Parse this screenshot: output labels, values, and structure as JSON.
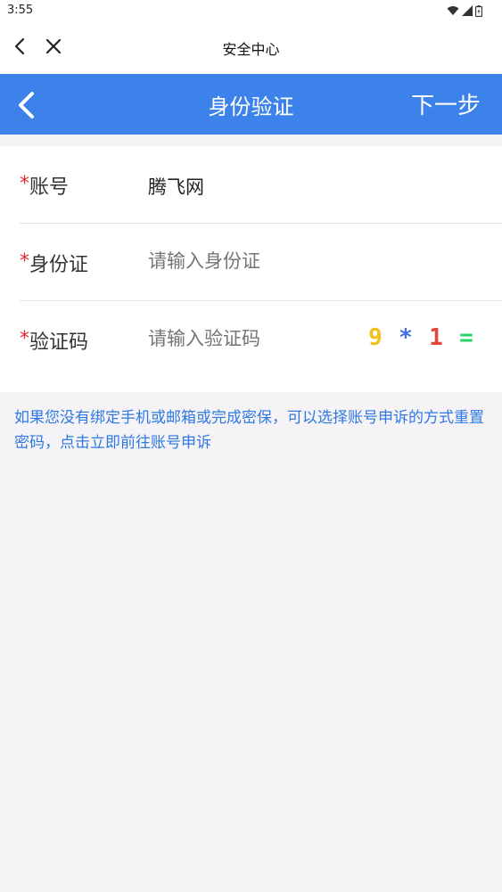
{
  "status": {
    "time": "3:55"
  },
  "webview": {
    "title": "安全中心"
  },
  "header": {
    "title": "身份验证",
    "next_label": "下一步"
  },
  "form": {
    "account": {
      "label": "账号",
      "value": "腾飞网"
    },
    "id_card": {
      "label": "身份证",
      "placeholder": "请输入身份证"
    },
    "captcha": {
      "label": "验证码",
      "placeholder": "请输入验证码",
      "chars": [
        {
          "text": "9",
          "color": "#f2c21b"
        },
        {
          "text": "*",
          "color": "#3f6fe0"
        },
        {
          "text": "1",
          "color": "#e2463a"
        },
        {
          "text": "=",
          "color": "#27d46b"
        }
      ]
    },
    "required_mark": "*"
  },
  "help": {
    "text": "如果您没有绑定手机或邮箱或完成密保，可以选择账号申诉的方式重置密码，",
    "link": "点击立即前往账号申诉"
  },
  "colors": {
    "accent": "#3c82ea",
    "required": "#e12b2b",
    "link": "#2f79e2"
  }
}
